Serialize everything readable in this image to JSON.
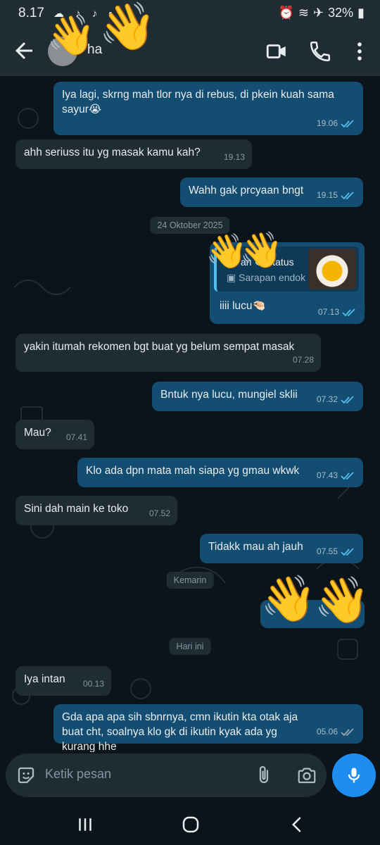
{
  "status_bar": {
    "time": "8.17",
    "battery": "32%"
  },
  "header": {
    "contact_name": "ha"
  },
  "messages": [
    {
      "dir": "out",
      "text": "Iya lagi, skrng mah tlor nya di rebus, di pkein kuah sama sayur😭",
      "time": "19.06"
    },
    {
      "dir": "in",
      "text": "ahh seriuss itu yg masak kamu kah?",
      "time": "19.13"
    },
    {
      "dir": "out",
      "text": "Wahh gak prcyaan bngt",
      "time": "19.15"
    },
    {
      "dir": "out",
      "text": "iiii lucu🤏🏻",
      "time": "07.13"
    },
    {
      "dir": "in",
      "text": "yakin itumah rekomen bgt buat yg belum sempat masak",
      "time": "07.28"
    },
    {
      "dir": "out",
      "text": "Bntuk nya lucu, mungiel sklii",
      "time": "07.32"
    },
    {
      "dir": "in",
      "text": "Mau?",
      "time": "07.41"
    },
    {
      "dir": "out",
      "text": "Klo ada dpn mata mah siapa yg gmau wkwk",
      "time": "07.43"
    },
    {
      "dir": "in",
      "text": "Sini dah main ke toko",
      "time": "07.52"
    },
    {
      "dir": "out",
      "text": "Tidakk mau ah jauh",
      "time": "07.55"
    },
    {
      "dir": "in",
      "text": "Iya intan",
      "time": "00.13"
    },
    {
      "dir": "out",
      "text": "Gda apa apa sih sbnrnya, cmn ikutin kta otak aja buat cht, soalnya klo gk di ikutin kyak ada yg kurang hhe",
      "time": "05.06"
    }
  ],
  "date_chips": [
    "24 Oktober 2025",
    "Kemarin",
    "Hari ini"
  ],
  "status_reply": {
    "title": "Status",
    "subtitle": "Sarapan endok",
    "prefix": "an"
  },
  "censor_emoji": "👋",
  "input": {
    "placeholder": "Ketik pesan"
  },
  "colors": {
    "outgoing": "#134d72",
    "incoming": "#1f2c34",
    "background": "#0b141a",
    "mic": "#1d8ef0",
    "read_ticks": "#53bdeb"
  },
  "icons": [
    "back-arrow-icon",
    "video-call-icon",
    "phone-icon",
    "more-vert-icon",
    "sticker-icon",
    "paperclip-icon",
    "camera-icon",
    "mic-icon",
    "recents-icon",
    "home-icon",
    "back-nav-icon"
  ]
}
